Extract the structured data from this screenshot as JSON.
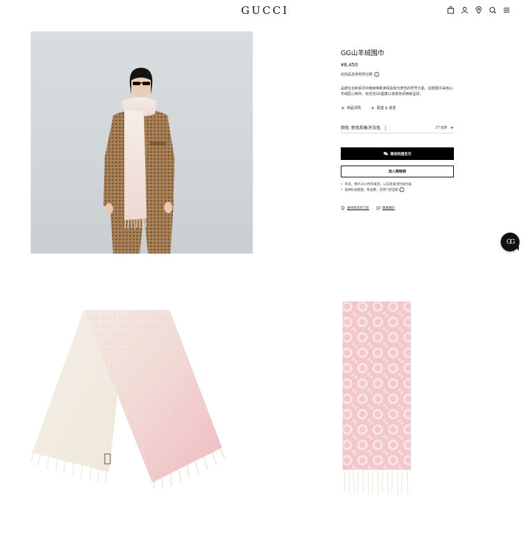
{
  "header": {
    "logo": "GUCCI",
    "icons": [
      "shopping-bag-icon",
      "account-icon",
      "location-pin-icon",
      "search-icon",
      "menu-icon"
    ]
  },
  "product": {
    "title": "GG山羊绒围巾",
    "price": "¥8,450",
    "installment_note": "此商品支持花呗分期",
    "description": "品牌在全新系列中继续焕新演绎具有代表性的符号元素。这款围巾采用山羊绒匠心制作，标志性GG图案以渐变色调焕新呈现。",
    "links": {
      "details": "商品详情",
      "shipping": "配送 & 退货"
    },
    "color": {
      "label": "颜色",
      "value": "粉色和象牙白色",
      "swatch": "#f3c4c9",
      "options": "2个选项"
    },
    "buttons": {
      "wechat_pay": "微信快捷支付",
      "add_to_cart": "加入购物袋"
    },
    "bullets": [
      "有货。预计24小时内发货，以实际发货时间为准",
      "选择标准配送，免运费。支持门店自提"
    ],
    "bottom_links": {
      "store_stock": "查找有货的门店",
      "contact": "联系我们"
    }
  },
  "chat": {
    "label": "GG"
  },
  "colors": {
    "accent": "#000000",
    "swatch_pink": "#f3c4c9",
    "scarf_ivory": "#f1ebe0",
    "scarf_pink": "#f0bcc3"
  }
}
